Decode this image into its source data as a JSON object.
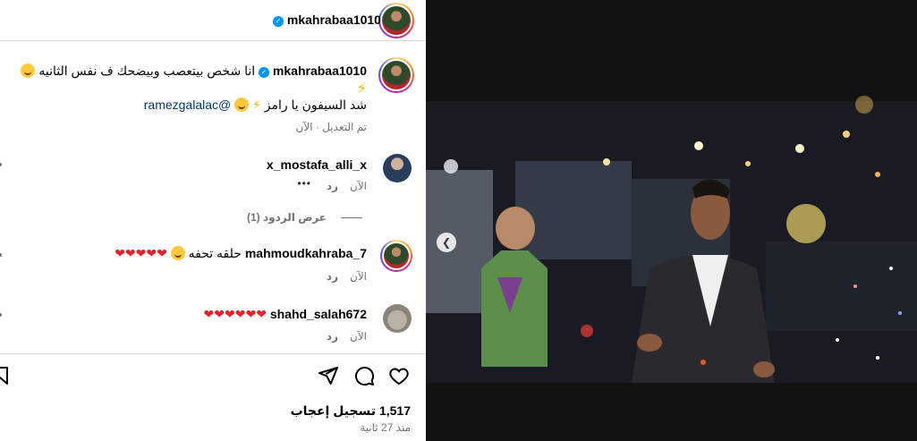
{
  "header": {
    "username": "mkahrabaa1010",
    "verified_icon": "verified-badge-icon"
  },
  "caption": {
    "username": "mkahrabaa1010",
    "line1": "انا شخص بيتعصب وبيضحك ف نفس الثانيه",
    "line2": "شد السيفون يا رامز",
    "mention": "@ramezgalalac",
    "meta": "تم التعديل · الآن"
  },
  "comments": [
    {
      "username": "x_mostafa_alli_x",
      "text": "",
      "time": "الآن",
      "reply": "رد",
      "more": "•••"
    },
    {
      "username": "mahmoudkahraba_7",
      "text": "حلقه تحفه",
      "time": "الآن",
      "reply": "رد"
    },
    {
      "username": "shahd_salah672",
      "text": "",
      "time": "الآن",
      "reply": "رد"
    }
  ],
  "view_replies": "عرض الردود (1)",
  "actions": {
    "likes": "1,517 تسجيل إعجاب",
    "time_ago": "منذ 27 ثانية"
  },
  "colors": {
    "verified": "#0095f6",
    "heart": "#e0242f",
    "muted": "#737373",
    "divider": "#dbdbdb"
  }
}
